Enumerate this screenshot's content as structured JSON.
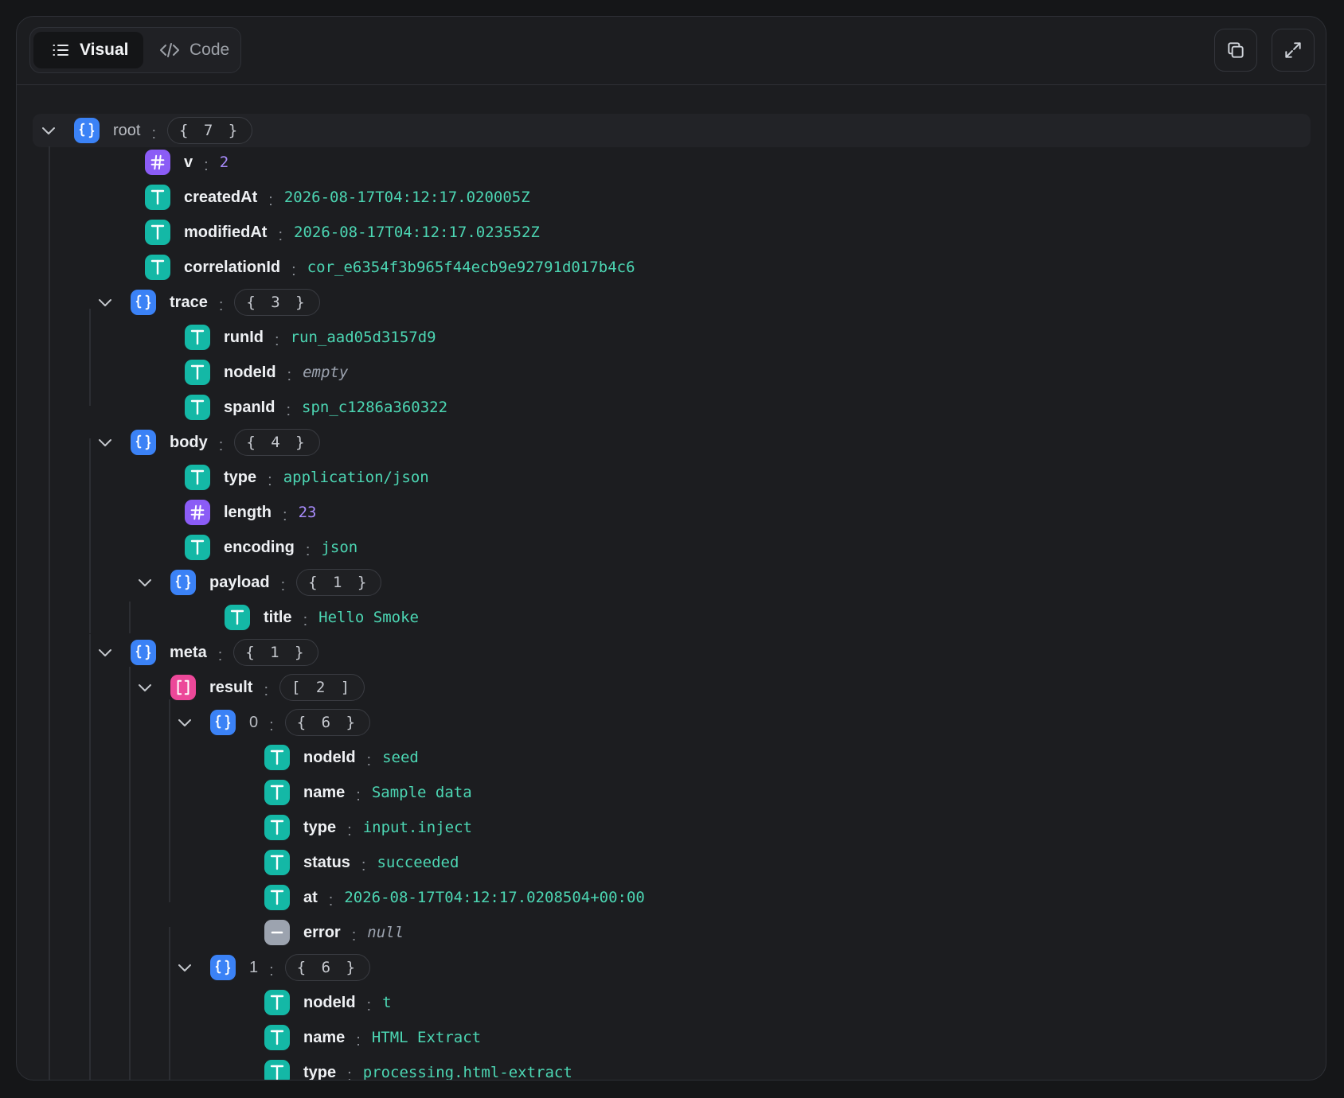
{
  "toolbar": {
    "tabs": [
      {
        "label": "Visual",
        "icon": "list-icon",
        "selected": true
      },
      {
        "label": "Code",
        "icon": "code-icon",
        "selected": false
      }
    ],
    "actions": [
      {
        "icon": "copy-icon"
      },
      {
        "icon": "expand-icon"
      }
    ]
  },
  "tree": {
    "root": {
      "key": "root",
      "count": "{ 7 }"
    },
    "v": {
      "key": "v",
      "value": "2"
    },
    "createdAt": {
      "key": "createdAt",
      "value": "2026-08-17T04:12:17.020005Z"
    },
    "modifiedAt": {
      "key": "modifiedAt",
      "value": "2026-08-17T04:12:17.023552Z"
    },
    "correlationId": {
      "key": "correlationId",
      "value": "cor_e6354f3b965f44ecb9e92791d017b4c6"
    },
    "trace": {
      "key": "trace",
      "count": "{ 3 }",
      "runId": {
        "key": "runId",
        "value": "run_aad05d3157d9"
      },
      "nodeId": {
        "key": "nodeId",
        "value": "empty"
      },
      "spanId": {
        "key": "spanId",
        "value": "spn_c1286a360322"
      }
    },
    "body": {
      "key": "body",
      "count": "{ 4 }",
      "type": {
        "key": "type",
        "value": "application/json"
      },
      "length": {
        "key": "length",
        "value": "23"
      },
      "encoding": {
        "key": "encoding",
        "value": "json"
      },
      "payload": {
        "key": "payload",
        "count": "{ 1 }",
        "title": {
          "key": "title",
          "value": "Hello Smoke"
        }
      }
    },
    "meta": {
      "key": "meta",
      "count": "{ 1 }",
      "result": {
        "key": "result",
        "count": "[ 2 ]",
        "items": [
          {
            "key": "0",
            "count": "{ 6 }",
            "nodeId": {
              "key": "nodeId",
              "value": "seed"
            },
            "name": {
              "key": "name",
              "value": "Sample data"
            },
            "type": {
              "key": "type",
              "value": "input.inject"
            },
            "status": {
              "key": "status",
              "value": "succeeded"
            },
            "at": {
              "key": "at",
              "value": "2026-08-17T04:12:17.0208504+00:00"
            },
            "error": {
              "key": "error",
              "value": "null"
            }
          },
          {
            "key": "1",
            "count": "{ 6 }",
            "nodeId": {
              "key": "nodeId",
              "value": "t"
            },
            "name": {
              "key": "name",
              "value": "HTML Extract"
            },
            "type": {
              "key": "type",
              "value": "processing.html-extract"
            }
          }
        ]
      }
    }
  }
}
